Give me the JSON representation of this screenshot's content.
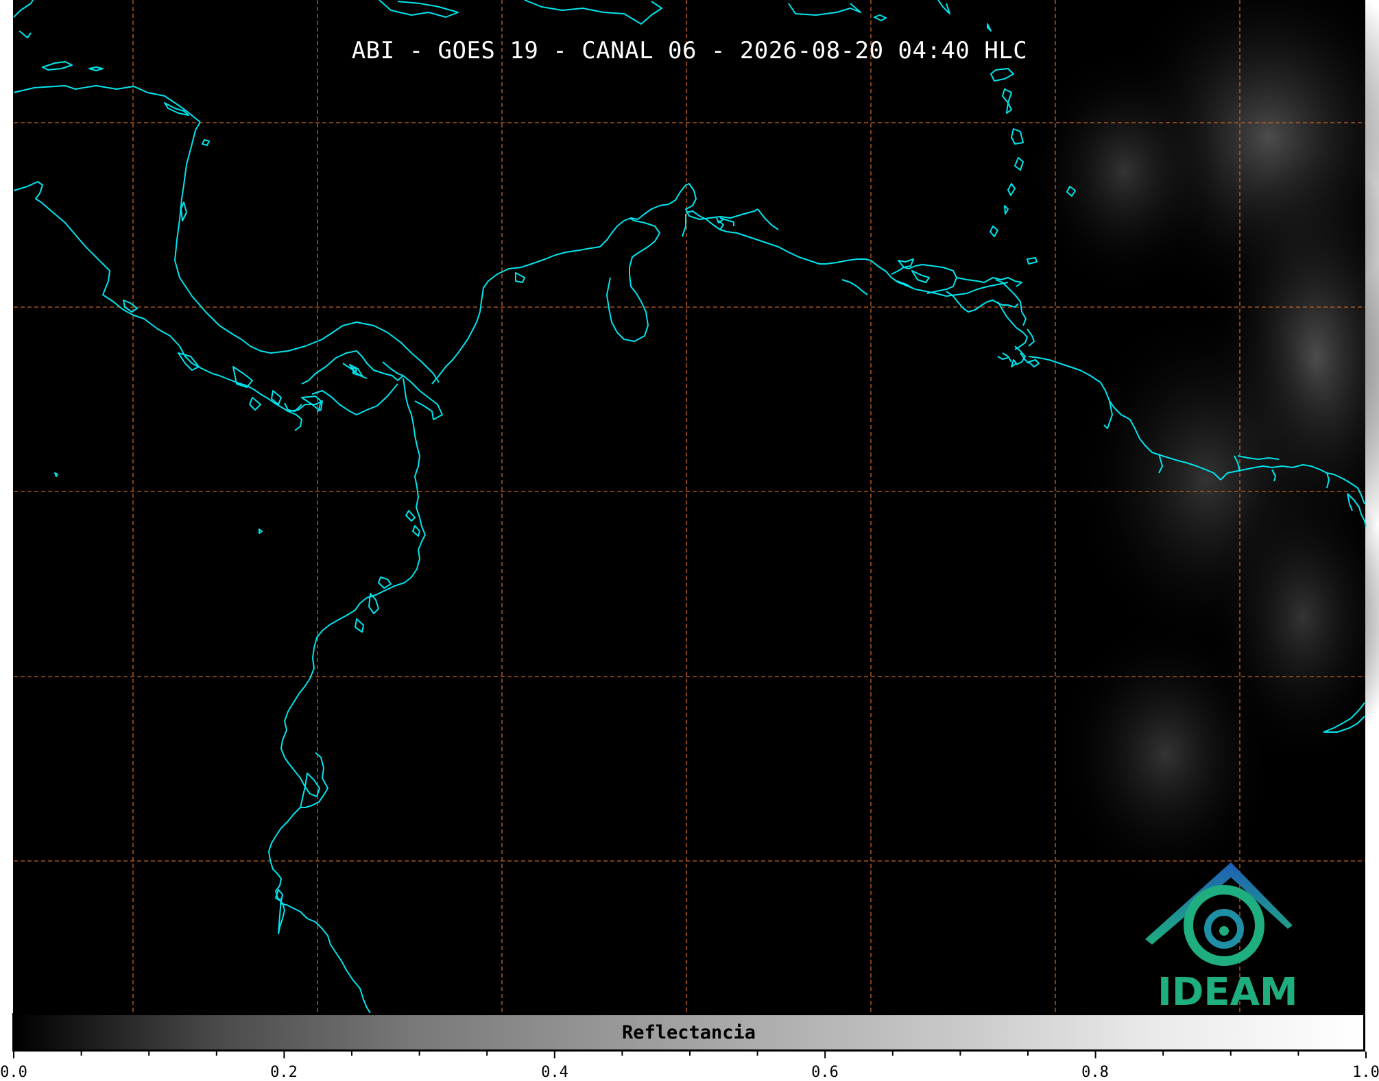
{
  "title": "ABI - GOES 19 - CANAL 06 - 2026-08-20 04:40 HLC",
  "colorbar": {
    "label": "Reflectancia",
    "ticks": [
      "0.0",
      "0.2",
      "0.4",
      "0.6",
      "0.8",
      "1.0"
    ],
    "range": [
      0.0,
      1.0
    ]
  },
  "logo": {
    "text": "IDEAM"
  },
  "colors": {
    "background": "#000000",
    "coastline": "#00e5ee",
    "gridline": "#c8641e",
    "logo_green": "#1fae7f",
    "logo_blue": "#1f6fb5"
  },
  "map": {
    "gridlines": "dashed",
    "grid_columns": 7,
    "grid_rows": 5
  }
}
